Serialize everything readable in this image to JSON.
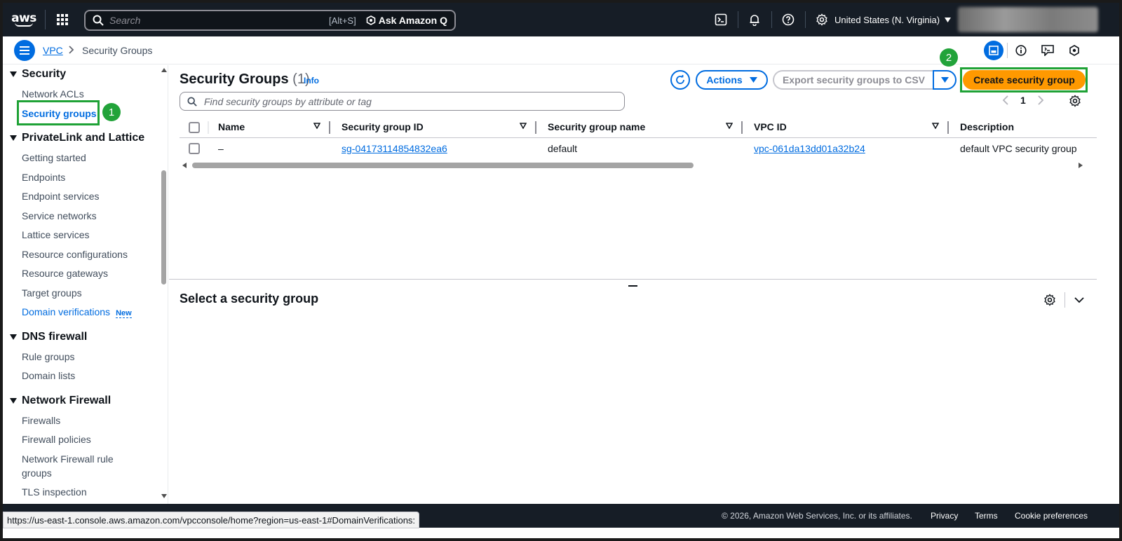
{
  "topnav": {
    "logo_text": "aws",
    "search_placeholder": "Search",
    "search_shortcut": "[Alt+S]",
    "ask_q_label": "Ask Amazon Q",
    "region_label": "United States (N. Virginia)"
  },
  "breadcrumb": {
    "items": [
      "VPC",
      "Security Groups"
    ]
  },
  "sidebar": {
    "sections": [
      {
        "label": "Security",
        "items": [
          "Network ACLs",
          "Security groups"
        ]
      },
      {
        "label": "PrivateLink and Lattice",
        "items": [
          "Getting started",
          "Endpoints",
          "Endpoint services",
          "Service networks",
          "Lattice services",
          "Resource configurations",
          "Resource gateways",
          "Target groups",
          "Domain verifications"
        ]
      },
      {
        "label": "DNS firewall",
        "items": [
          "Rule groups",
          "Domain lists"
        ]
      },
      {
        "label": "Network Firewall",
        "items": [
          "Firewalls",
          "Firewall policies",
          "Network Firewall rule groups",
          "TLS inspection configurations"
        ]
      }
    ],
    "network_fw_rule_line1": "Network Firewall rule",
    "network_fw_rule_line2": "groups",
    "tls_line1": "TLS inspection",
    "new_badge": "New",
    "active_item": "Security groups"
  },
  "annotations": {
    "badge1": "1",
    "badge2": "2"
  },
  "main": {
    "title": "Security Groups",
    "count": "(1)",
    "info_label": "Info",
    "actions_label": "Actions",
    "export_label": "Export security groups to CSV",
    "create_label": "Create security group",
    "filter_placeholder": "Find security groups by attribute or tag",
    "current_page": "1",
    "columns": [
      "Name",
      "Security group ID",
      "Security group name",
      "VPC ID",
      "Description"
    ],
    "rows": [
      {
        "name": "–",
        "id": "sg-04173114854832ea6",
        "group_name": "default",
        "vpc_id": "vpc-061da13dd01a32b24",
        "description": "default VPC security group"
      }
    ],
    "detail_title": "Select a security group"
  },
  "footer": {
    "copyright": "© 2026, Amazon Web Services, Inc. or its affiliates.",
    "links": [
      "Privacy",
      "Terms",
      "Cookie preferences"
    ]
  },
  "status_url": "https://us-east-1.console.aws.amazon.com/vpcconsole/home?region=us-east-1#DomainVerifications:",
  "colors": {
    "nav_bg": "#161d26",
    "link": "#006ce0",
    "primary_button": "#ff9900",
    "annotation_green": "#22a33a"
  }
}
